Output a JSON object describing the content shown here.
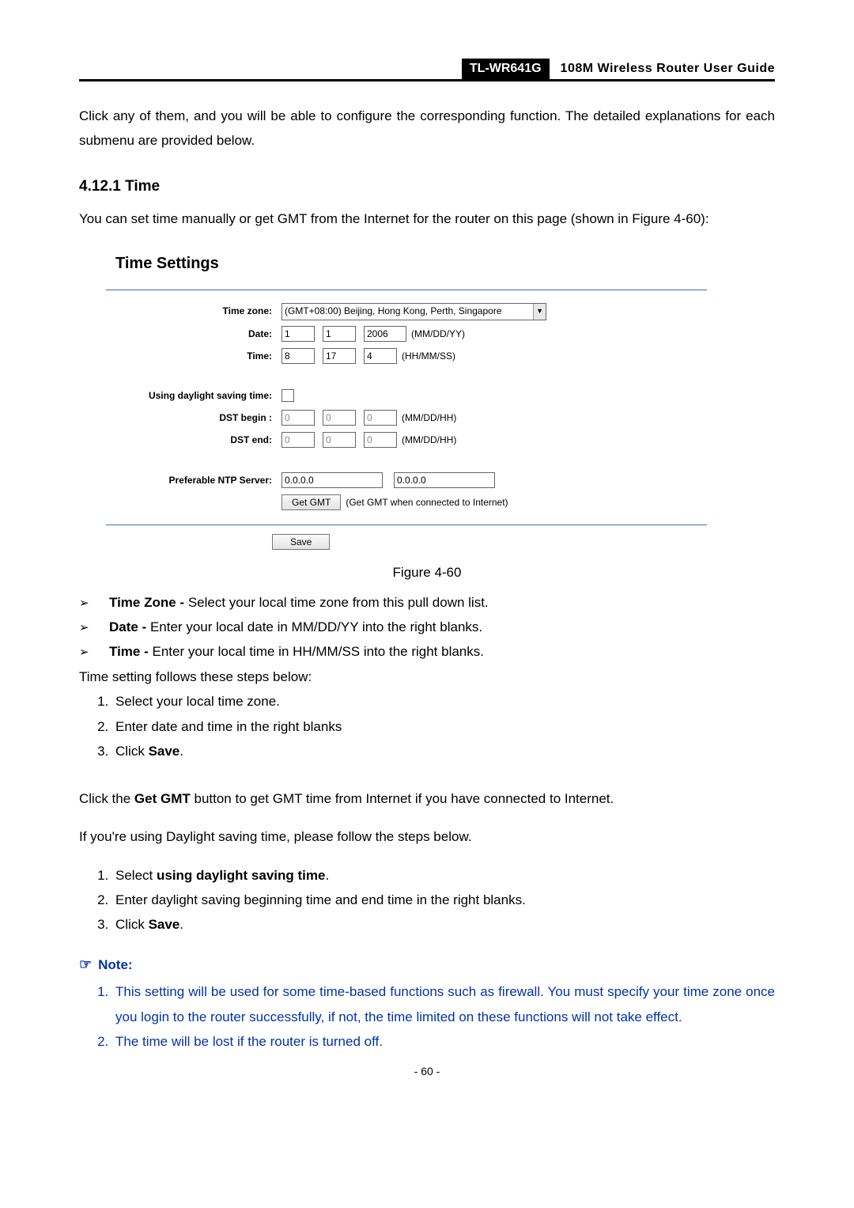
{
  "header": {
    "model": "TL-WR641G",
    "title": "108M Wireless Router User Guide"
  },
  "intro": "Click any of them, and you will be able to configure the corresponding function. The detailed explanations for each submenu are provided below.",
  "section_heading": "4.12.1 Time",
  "section_intro": "You can set time manually or get GMT from the Internet for the router on this page (shown in Figure 4-60):",
  "panel": {
    "title": "Time Settings",
    "timezone_label": "Time zone:",
    "timezone_value": "(GMT+08:00) Beijing, Hong Kong, Perth, Singapore",
    "date_label": "Date:",
    "date": {
      "mm": "1",
      "dd": "1",
      "yy": "2006",
      "hint": "(MM/DD/YY)"
    },
    "time_label": "Time:",
    "time": {
      "hh": "8",
      "mm": "17",
      "ss": "4",
      "hint": "(HH/MM/SS)"
    },
    "dst_use_label": "Using daylight saving time:",
    "dst_begin_label": "DST begin :",
    "dst_end_label": "DST end:",
    "dst_begin": {
      "a": "0",
      "b": "0",
      "c": "0",
      "hint": "(MM/DD/HH)"
    },
    "dst_end": {
      "a": "0",
      "b": "0",
      "c": "0",
      "hint": "(MM/DD/HH)"
    },
    "ntp_label": "Preferable NTP Server:",
    "ntp1": "0.0.0.0",
    "ntp2": "0.0.0.0",
    "getgmt_label": "Get GMT",
    "getgmt_hint": "(Get GMT when connected to Internet)",
    "save_label": "Save"
  },
  "figure_caption": "Figure 4-60",
  "bullets": [
    {
      "term": "Time Zone -",
      "text": " Select your local time zone from this pull down list."
    },
    {
      "term": "Date -",
      "text": " Enter your local date in MM/DD/YY into the right blanks."
    },
    {
      "term": "Time -",
      "text": " Enter your local time in HH/MM/SS into the right blanks."
    }
  ],
  "steps_intro": "Time setting follows these steps below:",
  "steps": [
    "Select your local time zone.",
    "Enter date and time in the right blanks",
    {
      "pre": "Click ",
      "bold": "Save",
      "post": "."
    }
  ],
  "getgmt_line": {
    "pre": "Click the ",
    "bold": "Get GMT",
    "post": " button to get GMT time from Internet if you have connected to Internet."
  },
  "dst_intro": "If you're using Daylight saving time, please follow the steps below.",
  "dst_steps": [
    {
      "pre": "Select ",
      "bold": "using daylight saving time",
      "post": "."
    },
    "Enter daylight saving beginning time and end time in the right blanks.",
    {
      "pre": "Click ",
      "bold": "Save",
      "post": "."
    }
  ],
  "note": {
    "heading": "Note:",
    "items": [
      "This setting will be used for some time-based functions such as firewall. You must specify your time zone once you login to the router successfully, if not, the time limited on these functions will not take effect.",
      "The time will be lost if the router is turned off."
    ]
  },
  "page_number": "- 60 -"
}
